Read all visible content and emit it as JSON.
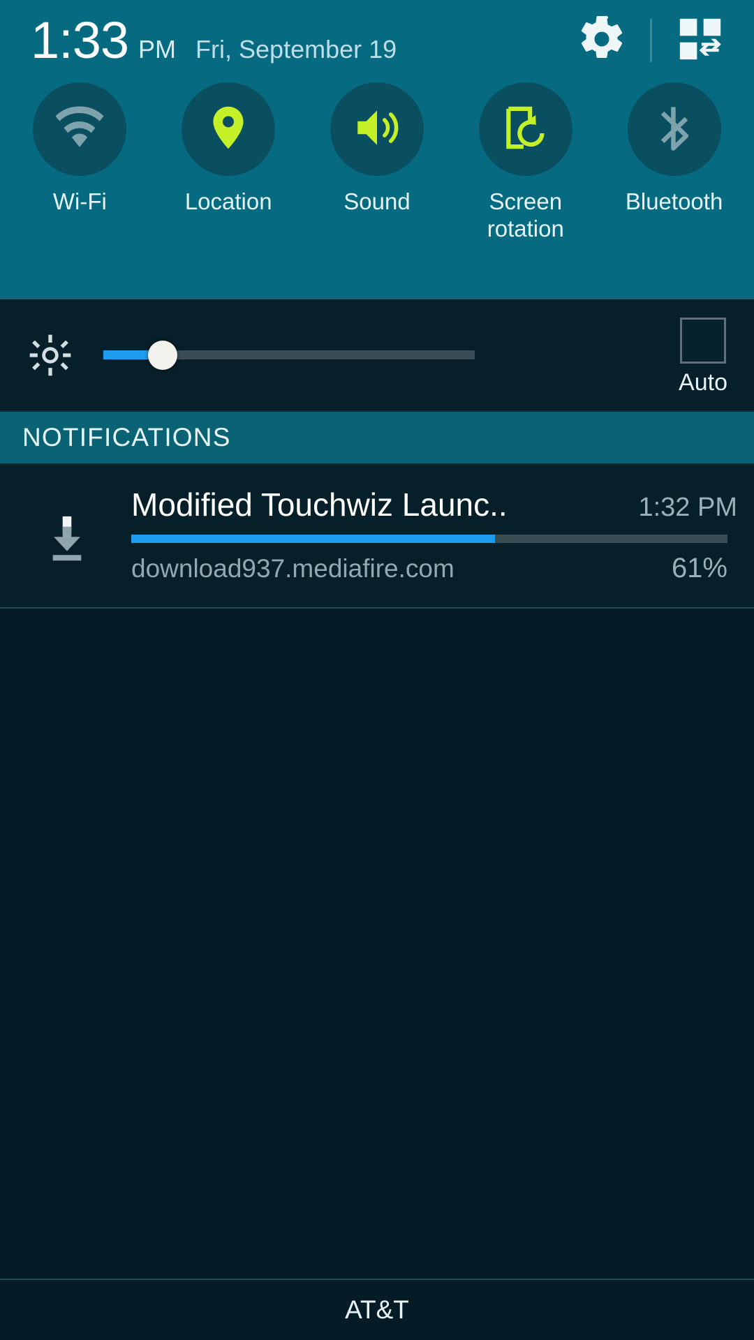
{
  "statusbar": {
    "time": "1:33",
    "ampm": "PM",
    "date": "Fri, September 19",
    "settings_icon": "gear-icon",
    "quick_settings_icon": "quick-settings-grid-icon"
  },
  "quick_toggles": [
    {
      "label": "Wi-Fi",
      "icon": "wifi-icon",
      "state": "off",
      "color": "#7fa3ac"
    },
    {
      "label": "Location",
      "icon": "location-pin-icon",
      "state": "on",
      "color": "#c3f026"
    },
    {
      "label": "Sound",
      "icon": "sound-speaker-icon",
      "state": "on",
      "color": "#c3f026"
    },
    {
      "label": "Screen\nrotation",
      "icon": "screen-rotation-icon",
      "state": "on",
      "color": "#c3f026"
    },
    {
      "label": "Bluetooth",
      "icon": "bluetooth-icon",
      "state": "off",
      "color": "#7fa3ac"
    }
  ],
  "brightness": {
    "icon": "brightness-sun-icon",
    "value_percent": 16,
    "fill_color": "#1e9cf0",
    "auto_label": "Auto",
    "auto_checked": false
  },
  "notifications_header": {
    "title": "NOTIFICATIONS"
  },
  "notification": {
    "icon": "download-icon",
    "title": "Modified Touchwiz Launc..",
    "time": "1:32 PM",
    "subtitle": "download937.mediafire.com",
    "percent_label": "61%",
    "progress": 61,
    "progress_color": "#1e9cf0"
  },
  "carrier": {
    "name": "AT&T"
  },
  "theme": {
    "header_teal": "#066b80",
    "panel_dark": "#051c26",
    "row_dark": "#061f29",
    "notif_header_teal": "#0a6275",
    "toggle_circle": "#0a4f5f",
    "accent_lime": "#c3f026",
    "accent_blue": "#1e9cf0"
  }
}
